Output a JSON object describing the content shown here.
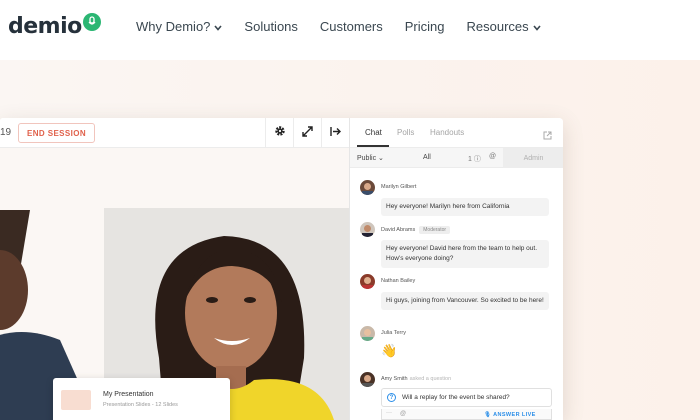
{
  "nav": {
    "logo_text": "demio",
    "items": [
      {
        "label": "Why Demio?",
        "has_dropdown": true
      },
      {
        "label": "Solutions",
        "has_dropdown": false
      },
      {
        "label": "Customers",
        "has_dropdown": false
      },
      {
        "label": "Pricing",
        "has_dropdown": false
      },
      {
        "label": "Resources",
        "has_dropdown": true
      }
    ]
  },
  "colors": {
    "brand_green": "#2bb673",
    "end_session_red": "#e0614b",
    "answer_blue": "#2d8fe8",
    "hero_bg": "#fbf3ee"
  },
  "toolbar": {
    "counter": "19",
    "end_session_label": "END SESSION",
    "icons": [
      "gear-icon",
      "expand-icon",
      "exit-icon"
    ]
  },
  "presentation": {
    "title": "My Presentation",
    "subtitle": "Presentation Slides - 12 Slides"
  },
  "chat": {
    "tabs": [
      "Chat",
      "Polls",
      "Handouts"
    ],
    "active_tab": "Chat",
    "filter_public": "Public",
    "filter_all": "All",
    "question_count": "1",
    "admin_label": "Admin",
    "messages": [
      {
        "name": "Marilyn Gilbert",
        "badge": "",
        "text": "Hey everyone! Marilyn here from California"
      },
      {
        "name": "David Abrams",
        "badge": "Moderator",
        "text": "Hey everyone! David here from the team to help out. How's everyone doing?"
      },
      {
        "name": "Nathan Bailey",
        "badge": "",
        "text": "Hi guys, joining from Vancouver. So excited to be here!"
      },
      {
        "name": "Julia Terry",
        "badge": "",
        "text": "👋"
      },
      {
        "name": "Amy Smith",
        "badge": "",
        "note": "asked a question",
        "text": "Will a replay for the event be shared?"
      }
    ],
    "answer_live_label": "ANSWER LIVE"
  }
}
